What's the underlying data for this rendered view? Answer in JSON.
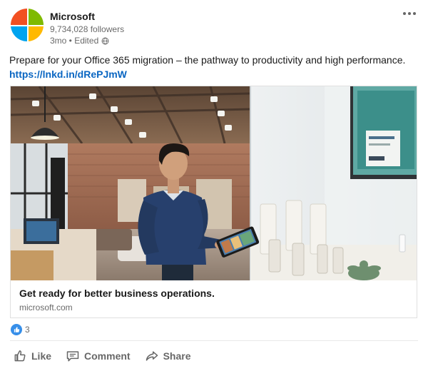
{
  "post": {
    "company_name": "Microsoft",
    "followers": "9,734,028 followers",
    "timeline": "3mo • Edited",
    "more_icon": "more-horizontal-icon",
    "body_text": "Prepare for your Office 365 migration – the pathway to productivity and high performance.",
    "link_text": "https://lnkd.in/dRePJmW"
  },
  "logo": {
    "colors": [
      "#f25022",
      "#7fba00",
      "#00a4ef",
      "#ffb900"
    ]
  },
  "card": {
    "title": "Get ready for better business operations.",
    "source": "microsoft.com",
    "image_description_icon": "office-photo"
  },
  "social": {
    "reaction_icon": "like-reaction-icon",
    "reaction_count": "3"
  },
  "actions": {
    "like": "Like",
    "comment": "Comment",
    "share": "Share"
  },
  "colors": {
    "link": "#0a66c2",
    "reaction_blue": "#378fe9"
  }
}
